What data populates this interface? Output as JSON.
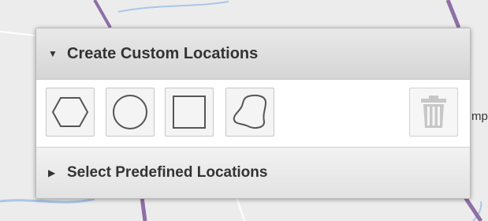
{
  "panel": {
    "custom_section": {
      "title": "Create Custom Locations",
      "expanded": true,
      "tools": [
        {
          "name": "polygon",
          "icon": "hexagon-icon"
        },
        {
          "name": "circle",
          "icon": "circle-icon"
        },
        {
          "name": "rectangle",
          "icon": "square-icon"
        },
        {
          "name": "freehand",
          "icon": "freeform-shape-icon"
        }
      ],
      "delete_icon": "trash-icon"
    },
    "predefined_section": {
      "title": "Select Predefined Locations",
      "expanded": false
    }
  },
  "map": {
    "partial_label": "mp"
  },
  "colors": {
    "map_background": "#ececec",
    "road_purple": "#8e6fa6",
    "water_blue": "#a9c6e8",
    "header_text": "#333333",
    "icon_stroke": "#555555",
    "trash_icon": "#c7c7c7"
  }
}
